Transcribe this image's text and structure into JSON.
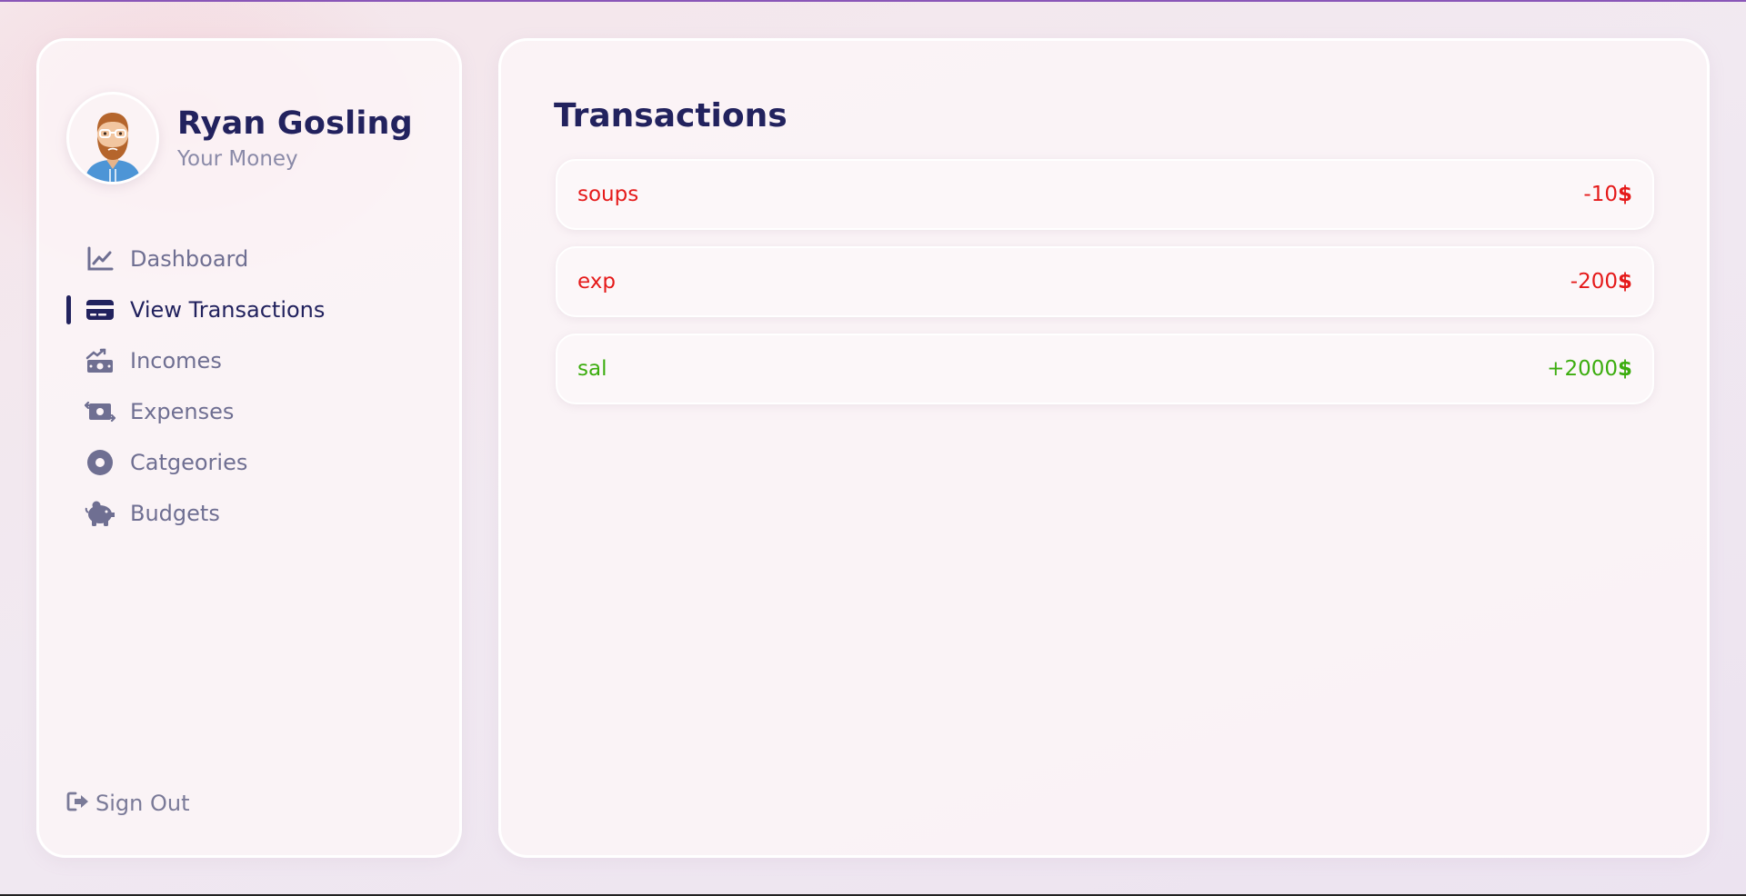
{
  "user": {
    "name": "Ryan Gosling",
    "subtitle": "Your Money"
  },
  "nav": [
    {
      "label": "Dashboard",
      "icon": "chart-line-icon",
      "active": false
    },
    {
      "label": "View Transactions",
      "icon": "credit-card-icon",
      "active": true
    },
    {
      "label": "Incomes",
      "icon": "money-bill-trend-up-icon",
      "active": false
    },
    {
      "label": "Expenses",
      "icon": "money-bill-transfer-icon",
      "active": false
    },
    {
      "label": "Catgeories",
      "icon": "circle-dot-icon",
      "active": false
    },
    {
      "label": "Budgets",
      "icon": "piggy-bank-icon",
      "active": false
    }
  ],
  "signout": {
    "label": "Sign Out",
    "icon": "sign-out-icon"
  },
  "main": {
    "title": "Transactions",
    "transactions": [
      {
        "name": "soups",
        "amount": "-10",
        "currency": "$",
        "type": "expense"
      },
      {
        "name": "exp",
        "amount": "-200",
        "currency": "$",
        "type": "expense"
      },
      {
        "name": "sal",
        "amount": "+2000",
        "currency": "$",
        "type": "income"
      }
    ]
  },
  "colors": {
    "primary": "#22225e",
    "muted": "#6f6f92",
    "expense": "#e51a1a",
    "income": "#3cad0f",
    "accent_line": "#8a57b8"
  }
}
